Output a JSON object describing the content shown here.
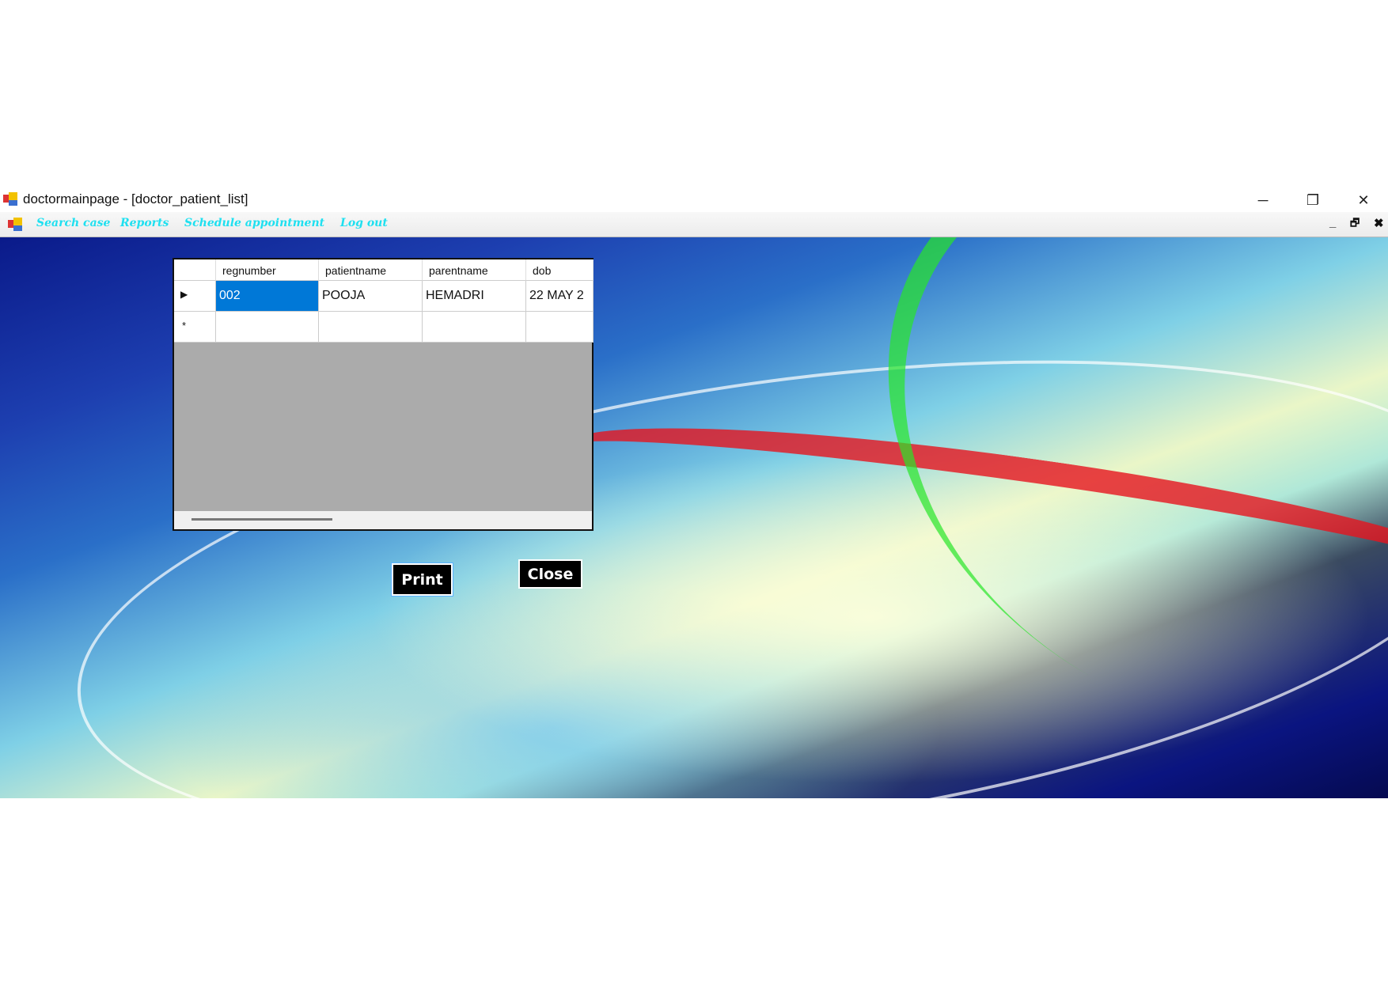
{
  "window": {
    "title": "doctormainpage - [doctor_patient_list]",
    "controls": [
      "minimize",
      "restore",
      "close"
    ]
  },
  "menu": {
    "items": [
      "Search case",
      "Reports",
      "Schedule appointment",
      "Log out"
    ],
    "color": "#1ee0f0"
  },
  "grid": {
    "columns": [
      "regnumber",
      "patientname",
      "parentname",
      "dob"
    ],
    "rows": [
      [
        "002",
        "POOJA",
        "HEMADRI",
        "22 MAY 2"
      ]
    ],
    "selected_color": "#0078d7"
  },
  "buttons": {
    "print": "Print",
    "close": "Close"
  },
  "icons": {
    "minimize": "─",
    "restore": "❐",
    "close": "✕",
    "mdi_minimize": "_",
    "mdi_restore": "🗗",
    "mdi_close": "✖",
    "row_current": "▶",
    "row_new": "*"
  }
}
